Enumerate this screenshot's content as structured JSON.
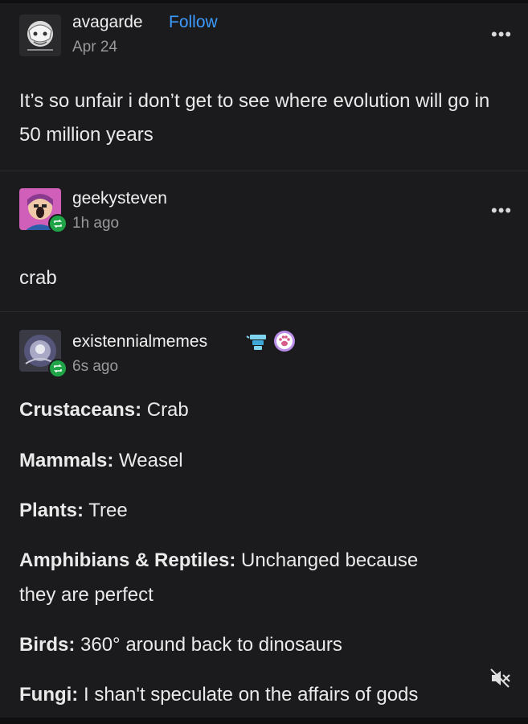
{
  "posts": [
    {
      "username": "avagarde",
      "follow_label": "Follow",
      "timestamp": "Apr 24",
      "text": "It’s so unfair i don’t get to see where evolution will go in 50 million years"
    },
    {
      "username": "geekysteven",
      "timestamp": "1h ago",
      "text": "crab"
    },
    {
      "username": "existennialmemes",
      "timestamp": "6s ago",
      "lines": [
        {
          "label": "Crustaceans:",
          "value": "Crab"
        },
        {
          "label": "Mammals:",
          "value": "Weasel"
        },
        {
          "label": "Plants:",
          "value": "Tree"
        },
        {
          "label": "Amphibians & Reptiles:",
          "value": "Unchanged because"
        },
        {
          "label": "",
          "value": "they are perfect"
        },
        {
          "label": "Birds:",
          "value": "360° around back to dinosaurs"
        },
        {
          "label": "Fungi:",
          "value": "I shan't speculate on the affairs of gods"
        }
      ]
    }
  ],
  "menu_glyph": "•••",
  "icons": {
    "more": "more-options-icon",
    "reblog": "reblog-icon",
    "mute": "mute-icon"
  },
  "colors": {
    "background": "#1b1b1d",
    "follow": "#3d9bff",
    "reblog_badge": "#1fa447"
  }
}
